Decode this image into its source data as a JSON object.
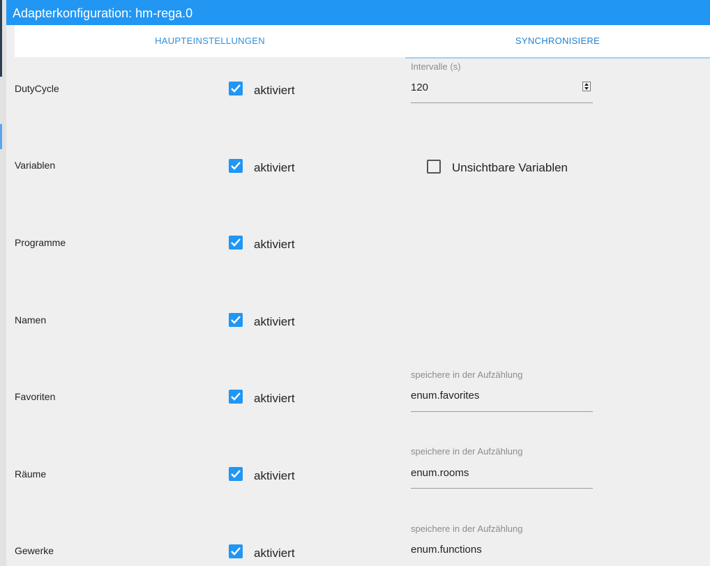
{
  "window": {
    "title": "Adapterkonfiguration: hm-rega.0"
  },
  "tabs": [
    {
      "label": "HAUPTEINSTELLUNGEN",
      "active": false
    },
    {
      "label": "SYNCHRONISIERE",
      "active": true
    }
  ],
  "rows": [
    {
      "label": "DutyCycle",
      "checkbox_label": "aktiviert",
      "checked": true
    },
    {
      "label": "Variablen",
      "checkbox_label": "aktiviert",
      "checked": true
    },
    {
      "label": "Programme",
      "checkbox_label": "aktiviert",
      "checked": true
    },
    {
      "label": "Namen",
      "checkbox_label": "aktiviert",
      "checked": true
    },
    {
      "label": "Favoriten",
      "checkbox_label": "aktiviert",
      "checked": true
    },
    {
      "label": "Räume",
      "checkbox_label": "aktiviert",
      "checked": true
    },
    {
      "label": "Gewerke",
      "checkbox_label": "aktiviert",
      "checked": true
    }
  ],
  "interval": {
    "label": "Intervalle (s)",
    "value": "120"
  },
  "hidden_vars": {
    "label": "Unsichtbare Variablen",
    "checked": false
  },
  "enum_fields": [
    {
      "label": "speichere in der Aufzählung",
      "value": "enum.favorites"
    },
    {
      "label": "speichere in der Aufzählung",
      "value": "enum.rooms"
    },
    {
      "label": "speichere in der Aufzählung",
      "value": "enum.functions"
    }
  ],
  "colors": {
    "accent": "#2196f3",
    "background": "#efefef",
    "tab_text": "#2f8fd8"
  }
}
